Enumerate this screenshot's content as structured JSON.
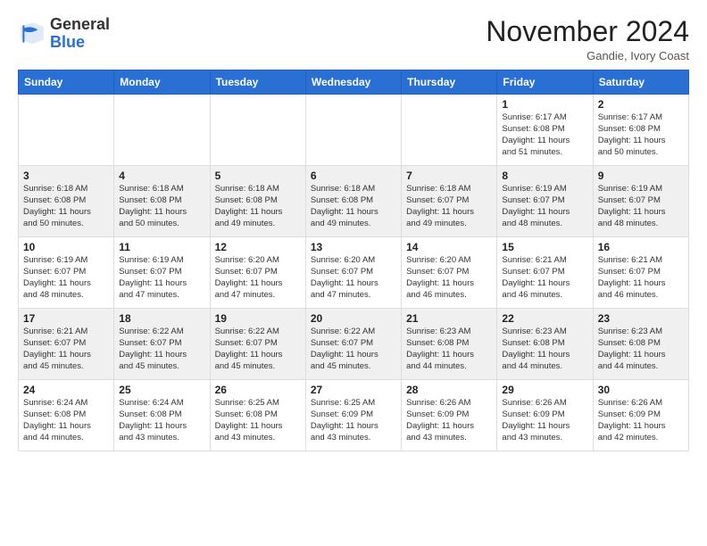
{
  "header": {
    "logo_general": "General",
    "logo_blue": "Blue",
    "month_title": "November 2024",
    "location": "Gandie, Ivory Coast"
  },
  "days_of_week": [
    "Sunday",
    "Monday",
    "Tuesday",
    "Wednesday",
    "Thursday",
    "Friday",
    "Saturday"
  ],
  "weeks": [
    [
      {
        "day": "",
        "info": ""
      },
      {
        "day": "",
        "info": ""
      },
      {
        "day": "",
        "info": ""
      },
      {
        "day": "",
        "info": ""
      },
      {
        "day": "",
        "info": ""
      },
      {
        "day": "1",
        "info": "Sunrise: 6:17 AM\nSunset: 6:08 PM\nDaylight: 11 hours\nand 51 minutes."
      },
      {
        "day": "2",
        "info": "Sunrise: 6:17 AM\nSunset: 6:08 PM\nDaylight: 11 hours\nand 50 minutes."
      }
    ],
    [
      {
        "day": "3",
        "info": "Sunrise: 6:18 AM\nSunset: 6:08 PM\nDaylight: 11 hours\nand 50 minutes."
      },
      {
        "day": "4",
        "info": "Sunrise: 6:18 AM\nSunset: 6:08 PM\nDaylight: 11 hours\nand 50 minutes."
      },
      {
        "day": "5",
        "info": "Sunrise: 6:18 AM\nSunset: 6:08 PM\nDaylight: 11 hours\nand 49 minutes."
      },
      {
        "day": "6",
        "info": "Sunrise: 6:18 AM\nSunset: 6:08 PM\nDaylight: 11 hours\nand 49 minutes."
      },
      {
        "day": "7",
        "info": "Sunrise: 6:18 AM\nSunset: 6:07 PM\nDaylight: 11 hours\nand 49 minutes."
      },
      {
        "day": "8",
        "info": "Sunrise: 6:19 AM\nSunset: 6:07 PM\nDaylight: 11 hours\nand 48 minutes."
      },
      {
        "day": "9",
        "info": "Sunrise: 6:19 AM\nSunset: 6:07 PM\nDaylight: 11 hours\nand 48 minutes."
      }
    ],
    [
      {
        "day": "10",
        "info": "Sunrise: 6:19 AM\nSunset: 6:07 PM\nDaylight: 11 hours\nand 48 minutes."
      },
      {
        "day": "11",
        "info": "Sunrise: 6:19 AM\nSunset: 6:07 PM\nDaylight: 11 hours\nand 47 minutes."
      },
      {
        "day": "12",
        "info": "Sunrise: 6:20 AM\nSunset: 6:07 PM\nDaylight: 11 hours\nand 47 minutes."
      },
      {
        "day": "13",
        "info": "Sunrise: 6:20 AM\nSunset: 6:07 PM\nDaylight: 11 hours\nand 47 minutes."
      },
      {
        "day": "14",
        "info": "Sunrise: 6:20 AM\nSunset: 6:07 PM\nDaylight: 11 hours\nand 46 minutes."
      },
      {
        "day": "15",
        "info": "Sunrise: 6:21 AM\nSunset: 6:07 PM\nDaylight: 11 hours\nand 46 minutes."
      },
      {
        "day": "16",
        "info": "Sunrise: 6:21 AM\nSunset: 6:07 PM\nDaylight: 11 hours\nand 46 minutes."
      }
    ],
    [
      {
        "day": "17",
        "info": "Sunrise: 6:21 AM\nSunset: 6:07 PM\nDaylight: 11 hours\nand 45 minutes."
      },
      {
        "day": "18",
        "info": "Sunrise: 6:22 AM\nSunset: 6:07 PM\nDaylight: 11 hours\nand 45 minutes."
      },
      {
        "day": "19",
        "info": "Sunrise: 6:22 AM\nSunset: 6:07 PM\nDaylight: 11 hours\nand 45 minutes."
      },
      {
        "day": "20",
        "info": "Sunrise: 6:22 AM\nSunset: 6:07 PM\nDaylight: 11 hours\nand 45 minutes."
      },
      {
        "day": "21",
        "info": "Sunrise: 6:23 AM\nSunset: 6:08 PM\nDaylight: 11 hours\nand 44 minutes."
      },
      {
        "day": "22",
        "info": "Sunrise: 6:23 AM\nSunset: 6:08 PM\nDaylight: 11 hours\nand 44 minutes."
      },
      {
        "day": "23",
        "info": "Sunrise: 6:23 AM\nSunset: 6:08 PM\nDaylight: 11 hours\nand 44 minutes."
      }
    ],
    [
      {
        "day": "24",
        "info": "Sunrise: 6:24 AM\nSunset: 6:08 PM\nDaylight: 11 hours\nand 44 minutes."
      },
      {
        "day": "25",
        "info": "Sunrise: 6:24 AM\nSunset: 6:08 PM\nDaylight: 11 hours\nand 43 minutes."
      },
      {
        "day": "26",
        "info": "Sunrise: 6:25 AM\nSunset: 6:08 PM\nDaylight: 11 hours\nand 43 minutes."
      },
      {
        "day": "27",
        "info": "Sunrise: 6:25 AM\nSunset: 6:09 PM\nDaylight: 11 hours\nand 43 minutes."
      },
      {
        "day": "28",
        "info": "Sunrise: 6:26 AM\nSunset: 6:09 PM\nDaylight: 11 hours\nand 43 minutes."
      },
      {
        "day": "29",
        "info": "Sunrise: 6:26 AM\nSunset: 6:09 PM\nDaylight: 11 hours\nand 43 minutes."
      },
      {
        "day": "30",
        "info": "Sunrise: 6:26 AM\nSunset: 6:09 PM\nDaylight: 11 hours\nand 42 minutes."
      }
    ]
  ]
}
